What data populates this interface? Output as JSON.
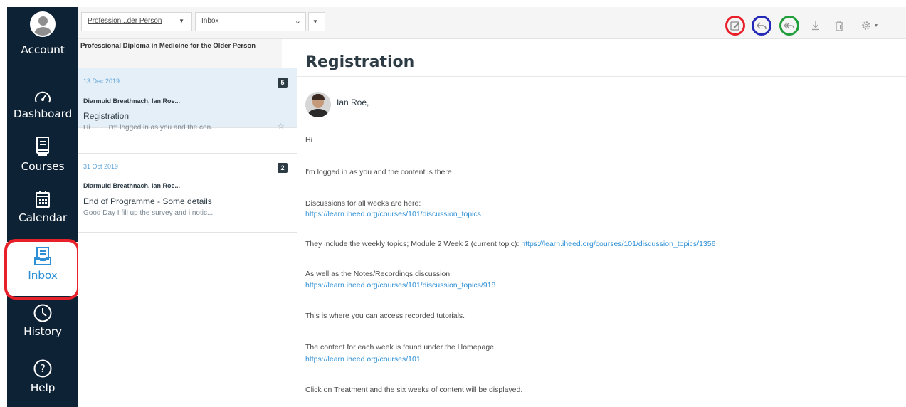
{
  "nav": {
    "account": "Account",
    "dashboard": "Dashboard",
    "courses": "Courses",
    "calendar": "Calendar",
    "inbox": "Inbox",
    "history": "History",
    "help": "Help"
  },
  "toolbar": {
    "course_filter": "Profession...der Person",
    "mailbox_filter": "Inbox"
  },
  "list": {
    "course_header": "Professional Diploma in Medicine for the Older Person",
    "conversations": [
      {
        "date": "13 Dec 2019",
        "count": "5",
        "participants": "Diarmuid Breathnach, Ian Roe...",
        "subject": "Registration",
        "preview_start": "Hi",
        "preview_rest": "I'm logged in as you and the con..."
      },
      {
        "date": "31 Oct 2019",
        "count": "2",
        "participants": "Diarmuid Breathnach, Ian Roe...",
        "subject": "End of Programme - Some details",
        "preview": "Good Day I fill up the survey and i notic..."
      }
    ]
  },
  "message": {
    "subject": "Registration",
    "sender": "Ian Roe,",
    "greeting": "Hi",
    "line1": "I'm logged in as you and the content is there.",
    "line2": "Discussions for all weeks are here:",
    "link1": "https://learn.iheed.org/courses/101/discussion_topics",
    "line4_text": "They include the weekly topics; Module 2 Week 2 (current topic): ",
    "link2": "https://learn.iheed.org/courses/101/discussion_topics/1356",
    "line5": "As well as the Notes/Recordings discussion:",
    "link3": "https://learn.iheed.org/courses/101/discussion_topics/918",
    "line7": "This is where you can access recorded tutorials.",
    "line8": "The content for each week is found under the Homepage",
    "link4": "https://learn.iheed.org/courses/101",
    "line10": "Click on Treatment and the six weeks of content will be displayed."
  },
  "colors": {
    "nav_bg": "#0e2236",
    "accent": "#2d8fd5",
    "highlight_red": "#e8202a",
    "highlight_blue": "#2429b8",
    "highlight_green": "#1f9e3a"
  }
}
